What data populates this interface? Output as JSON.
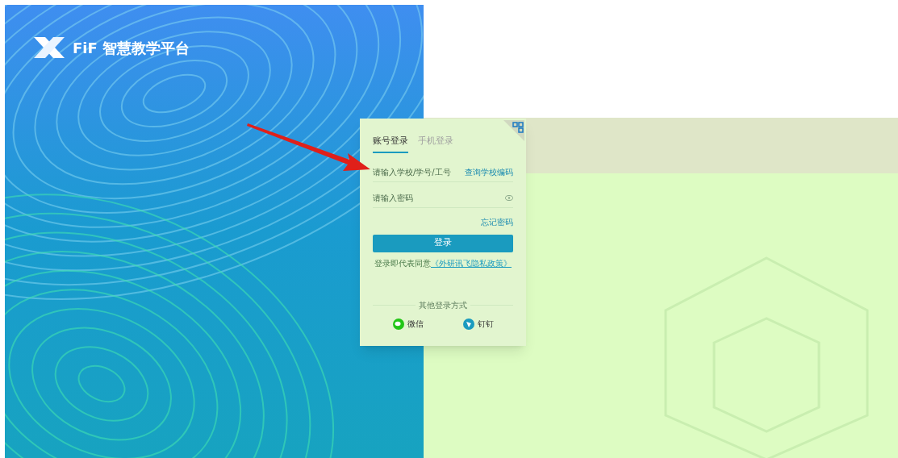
{
  "brand": {
    "name": "FiF 智慧教学平台"
  },
  "tabs": [
    {
      "label": "账号登录",
      "selected": true
    },
    {
      "label": "手机登录",
      "selected": false
    }
  ],
  "username": {
    "placeholder": "请输入学校/学号/工号",
    "link": "查询学校编码"
  },
  "password": {
    "placeholder": "请输入密码"
  },
  "forgot": "忘记密码",
  "submit": "登录",
  "agreement": {
    "text": "登录即代表同意",
    "link": "《外研讯飞隐私政策》"
  },
  "other": {
    "title": "其他登录方式",
    "methods": [
      {
        "kind": "wechat",
        "label": "微信"
      },
      {
        "kind": "dingtalk",
        "label": "钉钉"
      }
    ]
  }
}
